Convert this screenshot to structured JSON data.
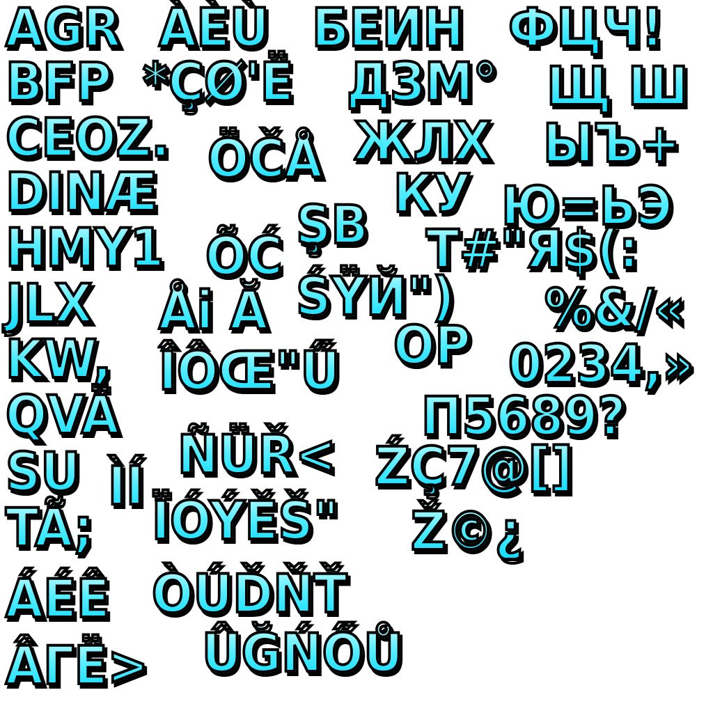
{
  "atlas": {
    "fill_colors": {
      "top": "#b9fbff",
      "middle": "#57eeff",
      "bottom": "#11dcff"
    },
    "outline_color": "#000000",
    "background": "#ffffff",
    "rows": [
      {
        "items": [
          "AGR",
          "ÀÈÙ",
          "БЕИН",
          "ФЦЧ!"
        ]
      },
      {
        "items": [
          "BFP",
          "*ÇØ'Ë",
          "ДЗМ°",
          "Щ Ш"
        ]
      },
      {
        "items": [
          "CEOZ.",
          "ÖČÅ",
          "ЖЛХ",
          "ЫЪ+"
        ]
      },
      {
        "items": [
          "DINÆ",
          "ŞB",
          "КУ",
          "Ю=ЬЭ"
        ]
      },
      {
        "items": [
          "HMY1",
          "ÕĆ",
          "Т#\"Я$(:"
        ]
      },
      {
        "items": [
          "JLX",
          "Åi Ă",
          "ŚŸЙ\")",
          "%&/«"
        ]
      },
      {
        "items": [
          "KW,",
          "ÎÔŒ\"Ű",
          "OP",
          "0234,»"
        ]
      },
      {
        "items": [
          "QVÄ",
          "П5689?"
        ]
      },
      {
        "items": [
          "SU",
          "ÌÍ",
          "ÑÜŘ<",
          "ŹÇ7@[]"
        ]
      },
      {
        "items": [
          "TÃ;",
          "ÏÓÝĚŠ\"",
          "Ž©¿"
        ]
      },
      {
        "items": [
          "ÁÉÊ",
          "ÒÚĎŇŤ"
        ]
      },
      {
        "items": [
          "ÂГË>",
          "ÛĞŃŐŮ"
        ]
      }
    ]
  }
}
